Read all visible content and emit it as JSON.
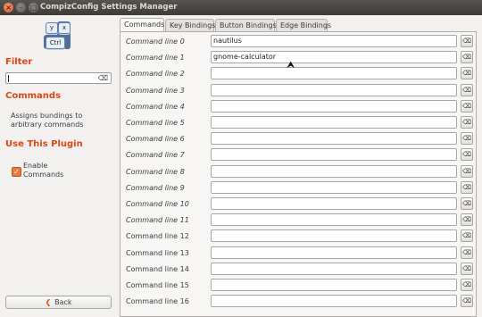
{
  "window": {
    "title": "CompizConfig Settings Manager"
  },
  "window_controls": {
    "close": "×",
    "minimize": "–",
    "maximize": "□"
  },
  "plugin_icon": {
    "key_y": "y",
    "key_x": "x",
    "key_ctrl": "Ctrl"
  },
  "sidebar": {
    "filter_heading": "Filter",
    "filter_value": "",
    "clear_glyph": "⌫",
    "plugin_heading": "Commands",
    "plugin_description": "Assigns bundings to arbitrary commands",
    "use_heading": "Use This Plugin",
    "enable_label": "Enable Commands",
    "enable_checked": true,
    "check_glyph": "✓",
    "back_label": "Back",
    "back_glyph": "❮"
  },
  "tabs": [
    {
      "label": "Commands",
      "active": true
    },
    {
      "label": "Key Bindings",
      "active": false
    },
    {
      "label": "Button Bindings",
      "active": false
    },
    {
      "label": "Edge Bindings",
      "active": false
    }
  ],
  "command_rows": [
    {
      "label": "Command line 0",
      "value": "nautilus",
      "italic": true
    },
    {
      "label": "Command line 1",
      "value": "gnome-calculator",
      "italic": true
    },
    {
      "label": "Command line 2",
      "value": "",
      "italic": true
    },
    {
      "label": "Command line 3",
      "value": "",
      "italic": true
    },
    {
      "label": "Command line 4",
      "value": "",
      "italic": true
    },
    {
      "label": "Command line 5",
      "value": "",
      "italic": true
    },
    {
      "label": "Command line 6",
      "value": "",
      "italic": true
    },
    {
      "label": "Command line 7",
      "value": "",
      "italic": true
    },
    {
      "label": "Command line 8",
      "value": "",
      "italic": true
    },
    {
      "label": "Command line 9",
      "value": "",
      "italic": true
    },
    {
      "label": "Command line 10",
      "value": "",
      "italic": true
    },
    {
      "label": "Command line 11",
      "value": "",
      "italic": true
    },
    {
      "label": "Command line 12",
      "value": "",
      "italic": false
    },
    {
      "label": "Command line 13",
      "value": "",
      "italic": false
    },
    {
      "label": "Command line 14",
      "value": "",
      "italic": false
    },
    {
      "label": "Command line 15",
      "value": "",
      "italic": false
    },
    {
      "label": "Command line 16",
      "value": "",
      "italic": false
    }
  ],
  "row_clear_glyph": "⌫",
  "colors": {
    "accent": "#dd4814",
    "titlebar": "#3d3c38",
    "background": "#f2f1f0"
  }
}
